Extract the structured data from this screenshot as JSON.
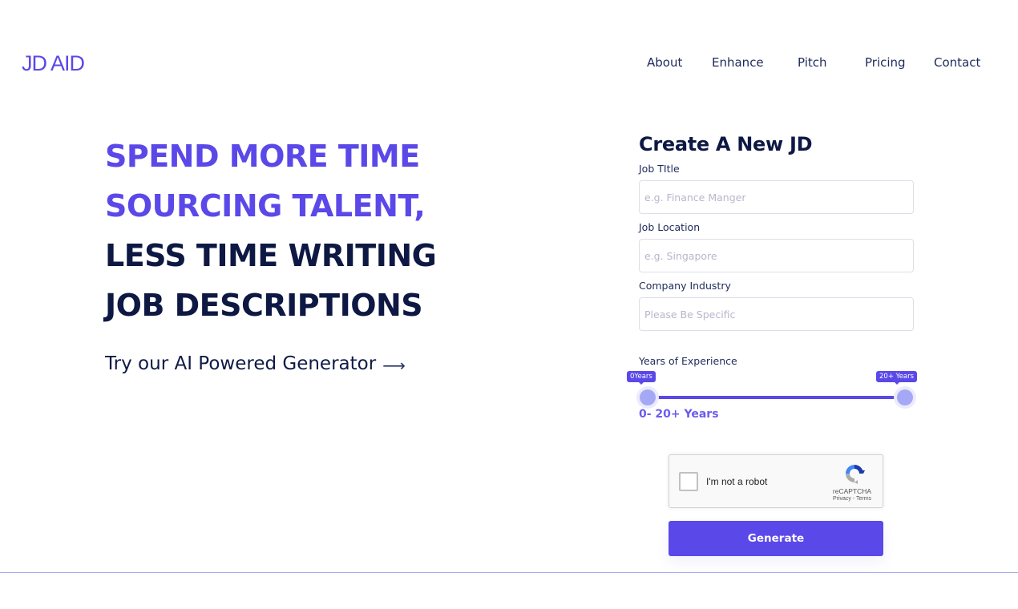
{
  "brand": {
    "logo_text": "JD AID",
    "accent_color": "#5b48e8",
    "dark_color": "#0d1843"
  },
  "nav": {
    "items": [
      {
        "label": "About"
      },
      {
        "label": "Enhance"
      },
      {
        "label": "Pitch"
      },
      {
        "label": "Pricing"
      },
      {
        "label": "Contact"
      }
    ]
  },
  "hero": {
    "lines": [
      {
        "text": "SPEND MORE TIME",
        "style": "accent"
      },
      {
        "text": "SOURCING TALENT,",
        "style": "accent"
      },
      {
        "text": "LESS TIME WRITING",
        "style": "dark"
      },
      {
        "text": "JOB DESCRIPTIONS",
        "style": "dark"
      }
    ],
    "cta_label": "Try our AI Powered Generator",
    "cta_arrow": "⟶"
  },
  "form": {
    "title": "Create A New JD",
    "fields": [
      {
        "label": "Job TItle",
        "placeholder": "e.g. Finance Manger",
        "value": ""
      },
      {
        "label": "Job Location",
        "placeholder": "e.g. Singapore",
        "value": ""
      },
      {
        "label": "Company Industry",
        "placeholder": "Please Be Specific",
        "value": ""
      }
    ],
    "experience": {
      "label": "Years of Experience",
      "min_value": 0,
      "max_value": 20,
      "min_tooltip": "0Years",
      "max_tooltip": "20+ Years",
      "range_text": "0- 20+ Years"
    },
    "captcha": {
      "label": "I'm not a robot",
      "brand": "reCAPTCHA",
      "terms": "Privacy - Terms",
      "checked": false
    },
    "generate_label": "Generate"
  }
}
